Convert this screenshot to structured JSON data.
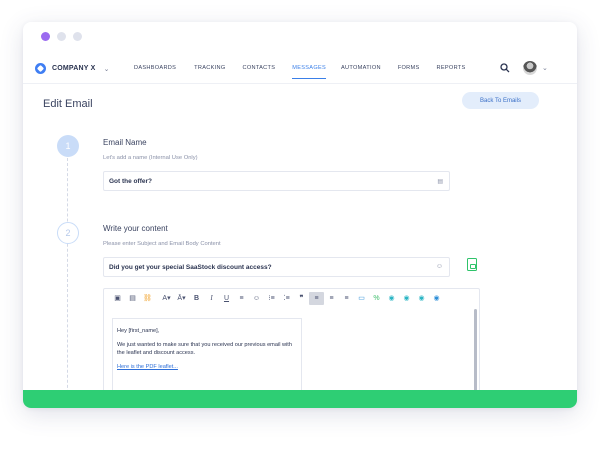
{
  "window": {
    "dots": [
      "active",
      "inactive",
      "inactive"
    ]
  },
  "nav": {
    "brand": "COMPANY X",
    "items": [
      {
        "label": "DASHBOARDS",
        "active": false
      },
      {
        "label": "TRACKING",
        "active": false
      },
      {
        "label": "CONTACTS",
        "active": false
      },
      {
        "label": "MESSAGES",
        "active": true
      },
      {
        "label": "AUTOMATION",
        "active": false
      },
      {
        "label": "FORMS",
        "active": false
      },
      {
        "label": "REPORTS",
        "active": false
      }
    ]
  },
  "page": {
    "title": "Edit Email",
    "back_button": "Back To Emails"
  },
  "step1": {
    "number": "1",
    "heading": "Email Name",
    "subtitle": "Let's add a name (Internal Use Only)",
    "value": "Got the offer?"
  },
  "step2": {
    "number": "2",
    "heading": "Write your content",
    "subtitle": "Please enter Subject and Email Body Content",
    "subject": "Did you get your special SaaStock discount access?"
  },
  "editor": {
    "toolbar": [
      "source-icon",
      "paste-icon",
      "link-icon",
      "font-color-icon",
      "bg-color-icon",
      "bold-icon",
      "italic-icon",
      "underline-icon",
      "strike-icon",
      "emoji-icon",
      "ordered-list-icon",
      "bullet-list-icon",
      "quote-icon",
      "align-left-icon",
      "align-center-icon",
      "align-right-icon",
      "image-icon",
      "variable-icon",
      "embed-icon-1",
      "embed-icon-2",
      "embed-icon-3",
      "embed-icon-4"
    ],
    "body": {
      "greeting": "Hey [first_name],",
      "paragraph": "We just wanted to make sure that you received our previous email with the leaflet and discount access.",
      "link": "Here is the PDF leaflet..."
    }
  },
  "colors": {
    "accent": "#3a7fe8",
    "footer": "#2ece74",
    "purple_dot": "#9b6bf0"
  }
}
